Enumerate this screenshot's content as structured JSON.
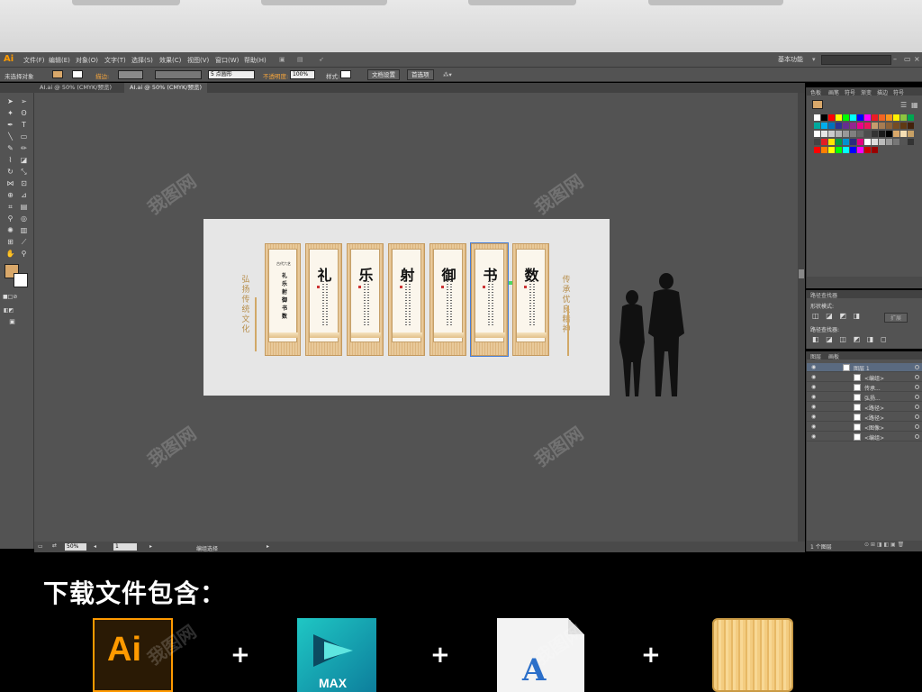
{
  "app": {
    "logo": "Ai",
    "workspace": "基本功能"
  },
  "menu": [
    "文件(F)",
    "编辑(E)",
    "对象(O)",
    "文字(T)",
    "选择(S)",
    "效果(C)",
    "视图(V)",
    "窗口(W)",
    "帮助(H)"
  ],
  "control": {
    "no_selection": "未选择对象",
    "stroke_label": "描边:",
    "brush": "5 点圆形",
    "opacity_label": "不透明度:",
    "opacity_value": "100%",
    "style_label": "样式:",
    "doc_setup": "文档设置",
    "preferences": "首选项"
  },
  "tabs": [
    "AI.ai @ 50% (CMYK/预览)",
    "AI.ai @ 50% (CMYK/预览)"
  ],
  "status": {
    "zoom": "50%",
    "page": "1",
    "mode": "编组选择"
  },
  "artwork": {
    "intro_title": "古代六艺",
    "intro_chars": [
      "礼",
      "乐",
      "射",
      "御",
      "书",
      "数"
    ],
    "panels": [
      "礼",
      "乐",
      "射",
      "御",
      "书",
      "数"
    ],
    "slogan_left": [
      "弘",
      "扬",
      "传",
      "统",
      "文",
      "化"
    ],
    "slogan_right": [
      "传",
      "承",
      "优",
      "良",
      "精",
      "神"
    ]
  },
  "right_panel": {
    "swatch_tabs": [
      "色板",
      "画笔",
      "符号",
      "渐变",
      "描边",
      "符号"
    ],
    "pathfinder_title": "路径查找器",
    "shape_modes": "形状模式:",
    "expand": "扩展",
    "pathfinders": "路径查找器:",
    "layers_tabs": [
      "图层",
      "画板"
    ],
    "layers": [
      {
        "name": "图层 1",
        "indent": 0
      },
      {
        "name": "<编组>",
        "indent": 1
      },
      {
        "name": "传承...",
        "indent": 1
      },
      {
        "name": "弘扬...",
        "indent": 1
      },
      {
        "name": "<路径>",
        "indent": 1
      },
      {
        "name": "<路径>",
        "indent": 1
      },
      {
        "name": "<图像>",
        "indent": 1
      },
      {
        "name": "<编组>",
        "indent": 1
      }
    ],
    "layer_count": "1 个图层"
  },
  "promo": {
    "title": "下载文件包含：",
    "files": [
      {
        "name": "ai-file-icon",
        "label": "Ai"
      },
      {
        "name": "3ds-max-icon",
        "label": "MAX"
      },
      {
        "name": "font-file-icon",
        "label": "A"
      },
      {
        "name": "wood-texture-icon",
        "label": ""
      }
    ],
    "plus": "+"
  },
  "watermark": "我图网",
  "colors": {
    "accent": "#ff9a00",
    "wood": "#dcb57e",
    "selection": "#4a7fd6",
    "ui_bg": "#535353"
  }
}
